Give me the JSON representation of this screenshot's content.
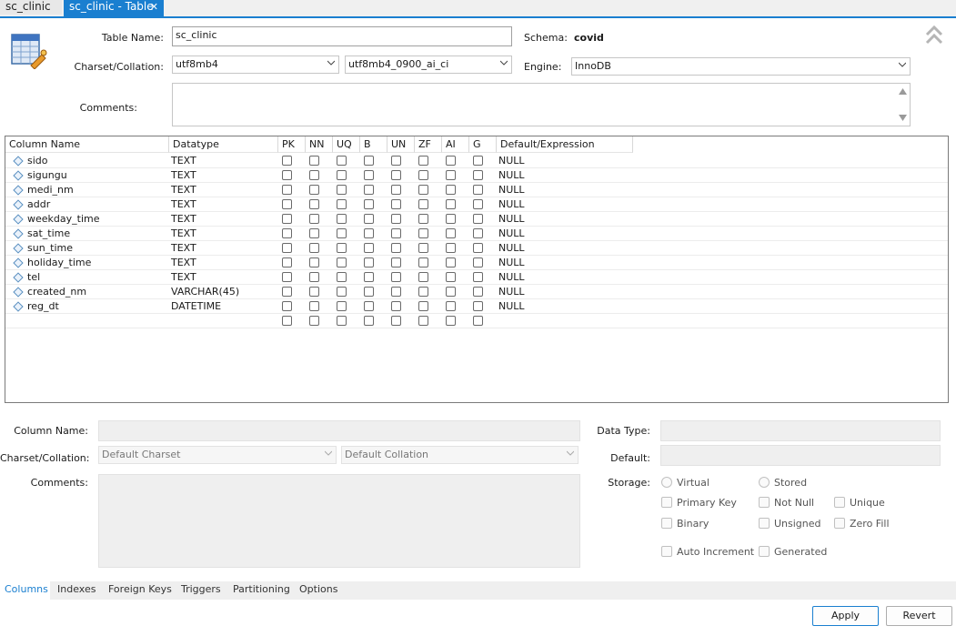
{
  "tabs": [
    {
      "label": "sc_clinic"
    },
    {
      "label": "sc_clinic - Table"
    }
  ],
  "table_props": {
    "table_name_label": "Table Name:",
    "table_name_value": "sc_clinic",
    "schema_label": "Schema:",
    "schema_value": "covid",
    "charset_label": "Charset/Collation:",
    "charset_value": "utf8mb4",
    "collation_value": "utf8mb4_0900_ai_ci",
    "engine_label": "Engine:",
    "engine_value": "InnoDB",
    "comments_label": "Comments:"
  },
  "grid": {
    "headers": [
      "Column Name",
      "Datatype",
      "PK",
      "NN",
      "UQ",
      "B",
      "UN",
      "ZF",
      "AI",
      "G",
      "Default/Expression"
    ],
    "rows": [
      {
        "name": "sido",
        "type": "TEXT",
        "default": "NULL"
      },
      {
        "name": "sigungu",
        "type": "TEXT",
        "default": "NULL"
      },
      {
        "name": "medi_nm",
        "type": "TEXT",
        "default": "NULL"
      },
      {
        "name": "addr",
        "type": "TEXT",
        "default": "NULL"
      },
      {
        "name": "weekday_time",
        "type": "TEXT",
        "default": "NULL"
      },
      {
        "name": "sat_time",
        "type": "TEXT",
        "default": "NULL"
      },
      {
        "name": "sun_time",
        "type": "TEXT",
        "default": "NULL"
      },
      {
        "name": "holiday_time",
        "type": "TEXT",
        "default": "NULL"
      },
      {
        "name": "tel",
        "type": "TEXT",
        "default": "NULL"
      },
      {
        "name": "created_nm",
        "type": "VARCHAR(45)",
        "default": "NULL"
      },
      {
        "name": "reg_dt",
        "type": "DATETIME",
        "default": "NULL"
      }
    ]
  },
  "column_props": {
    "column_name_label": "Column Name:",
    "charset_label": "Charset/Collation:",
    "charset_placeholder": "Default Charset",
    "collation_placeholder": "Default Collation",
    "comments_label": "Comments:",
    "datatype_label": "Data Type:",
    "default_label": "Default:",
    "storage_label": "Storage:",
    "virtual": "Virtual",
    "stored": "Stored",
    "primary_key": "Primary Key",
    "not_null": "Not Null",
    "unique": "Unique",
    "binary": "Binary",
    "unsigned": "Unsigned",
    "zero_fill": "Zero Fill",
    "auto_increment": "Auto Increment",
    "generated": "Generated"
  },
  "bottom_tabs": [
    "Columns",
    "Indexes",
    "Foreign Keys",
    "Triggers",
    "Partitioning",
    "Options"
  ],
  "buttons": {
    "apply": "Apply",
    "revert": "Revert"
  },
  "colors": {
    "accent": "#1a7fd0"
  }
}
